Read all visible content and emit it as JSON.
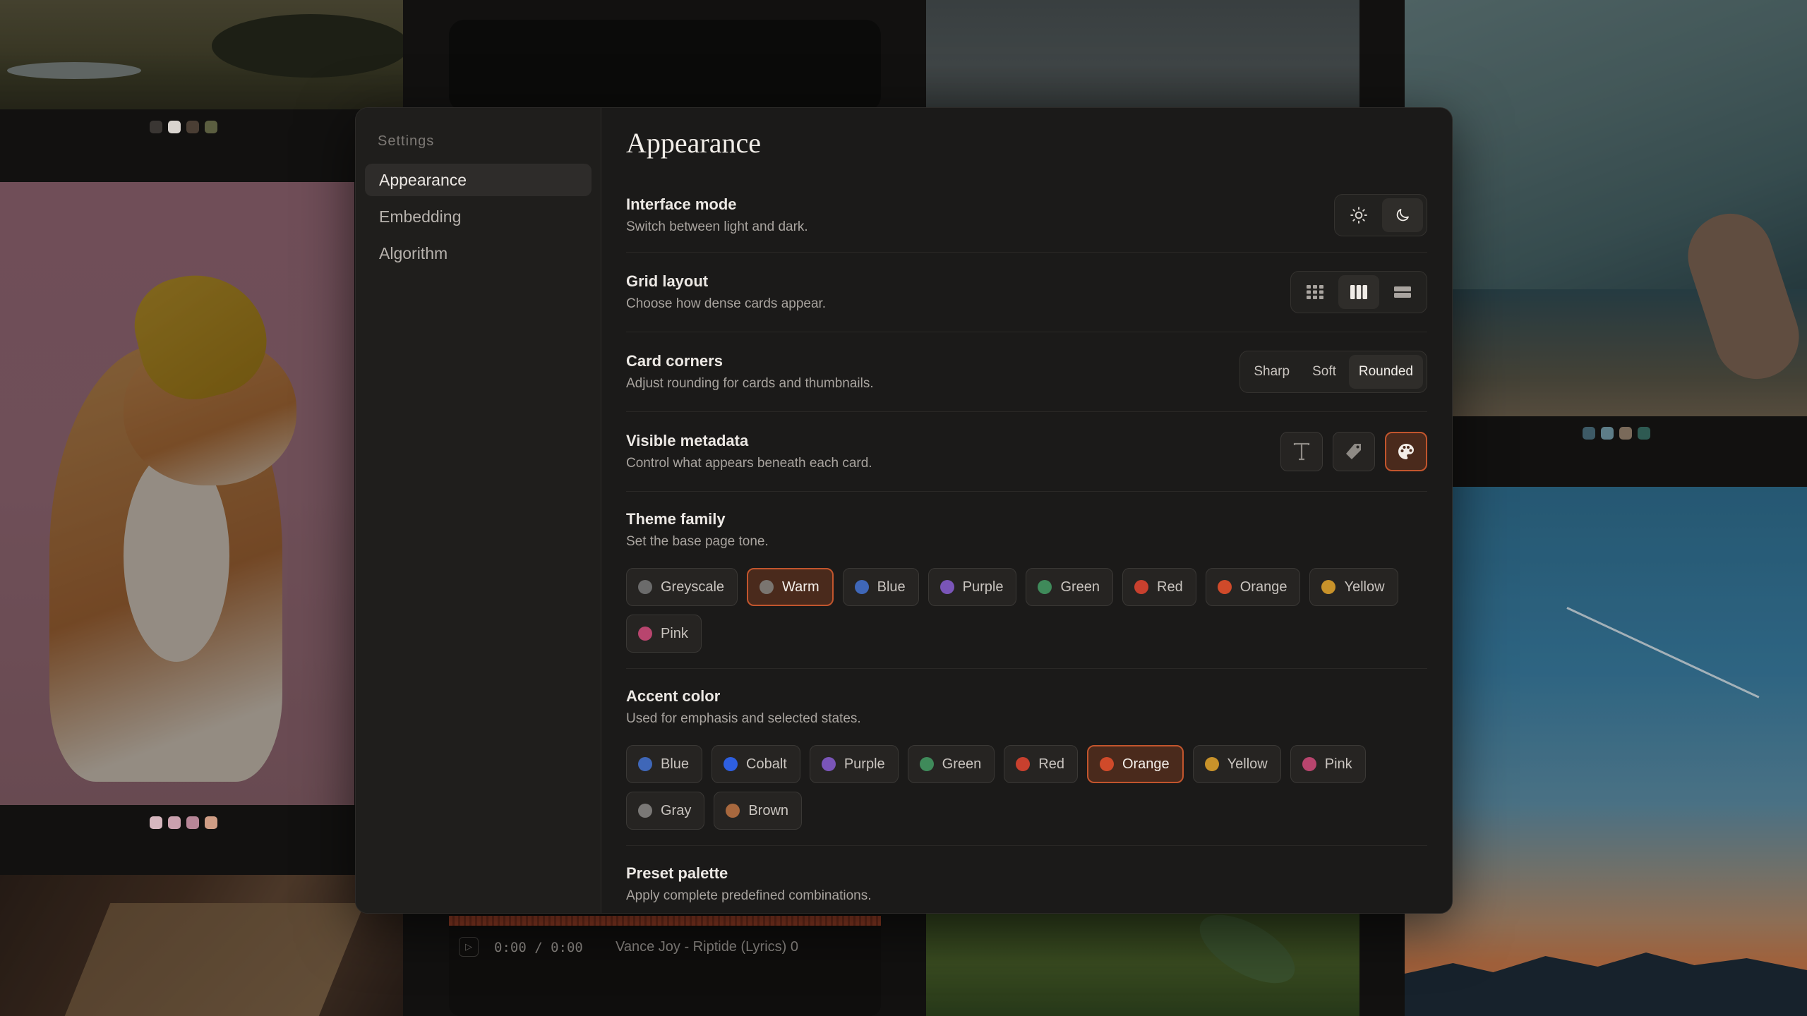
{
  "gallery": {
    "song_player": {
      "time": "0:00 / 0:00",
      "title": "Vance Joy - Riptide (Lyrics) 0",
      "play_glyph": "▷"
    },
    "palette_dots": [
      [
        "#3a3633",
        "#d9d4cf",
        "#4a3e34",
        "#5b5e40"
      ],
      [
        "#d6b7bf",
        "#caa1ae",
        "#b78697",
        "#cf9d85"
      ],
      [
        "#3d5a66",
        "#5d7d88",
        "#7a6a5a",
        "#2e5a52"
      ]
    ]
  },
  "sidebar": {
    "heading": "Settings",
    "items": [
      {
        "label": "Appearance",
        "active": true
      },
      {
        "label": "Embedding",
        "active": false
      },
      {
        "label": "Algorithm",
        "active": false
      }
    ]
  },
  "main": {
    "title": "Appearance",
    "interface_mode": {
      "label": "Interface mode",
      "desc": "Switch between light and dark.",
      "options": [
        "sun-icon",
        "moon-icon"
      ],
      "selected": "moon-icon"
    },
    "grid_layout": {
      "label": "Grid layout",
      "desc": "Choose how dense cards appear.",
      "options": [
        "grid-dense-icon",
        "grid-columns-icon",
        "grid-rows-icon"
      ],
      "selected": "grid-columns-icon"
    },
    "card_corners": {
      "label": "Card corners",
      "desc": "Adjust rounding for cards and thumbnails.",
      "options": [
        "Sharp",
        "Soft",
        "Rounded"
      ],
      "selected": "Rounded"
    },
    "visible_metadata": {
      "label": "Visible metadata",
      "desc": "Control what appears beneath each card.",
      "options": [
        "text-icon",
        "tag-icon",
        "palette-icon"
      ],
      "enabled": [
        "palette-icon"
      ]
    },
    "theme_family": {
      "label": "Theme family",
      "desc": "Set the base page tone.",
      "selected": "Warm",
      "options": [
        {
          "label": "Greyscale",
          "color": "#6b6b6b"
        },
        {
          "label": "Warm",
          "color": "#7a7570"
        },
        {
          "label": "Blue",
          "color": "#3f67b8"
        },
        {
          "label": "Purple",
          "color": "#7a55b8"
        },
        {
          "label": "Green",
          "color": "#3f8a5a"
        },
        {
          "label": "Red",
          "color": "#c8402e"
        },
        {
          "label": "Orange",
          "color": "#d04a2a"
        },
        {
          "label": "Yellow",
          "color": "#c8922a"
        },
        {
          "label": "Pink",
          "color": "#b8456e"
        }
      ]
    },
    "accent_color": {
      "label": "Accent color",
      "desc": "Used for emphasis and selected states.",
      "selected": "Orange",
      "options": [
        {
          "label": "Blue",
          "color": "#3f67b8"
        },
        {
          "label": "Cobalt",
          "color": "#2e5fe0"
        },
        {
          "label": "Purple",
          "color": "#7a55b8"
        },
        {
          "label": "Green",
          "color": "#3f8a5a"
        },
        {
          "label": "Red",
          "color": "#c8402e"
        },
        {
          "label": "Orange",
          "color": "#d04a2a"
        },
        {
          "label": "Yellow",
          "color": "#c8922a"
        },
        {
          "label": "Pink",
          "color": "#b8456e"
        },
        {
          "label": "Gray",
          "color": "#7a7876"
        },
        {
          "label": "Brown",
          "color": "#a8683e"
        }
      ]
    },
    "preset_palette": {
      "label": "Preset palette",
      "desc": "Apply complete predefined combinations."
    }
  },
  "colors": {
    "accent": "#c2552d",
    "panel": "#1b1a19",
    "sidebar": "#1f1e1c"
  }
}
